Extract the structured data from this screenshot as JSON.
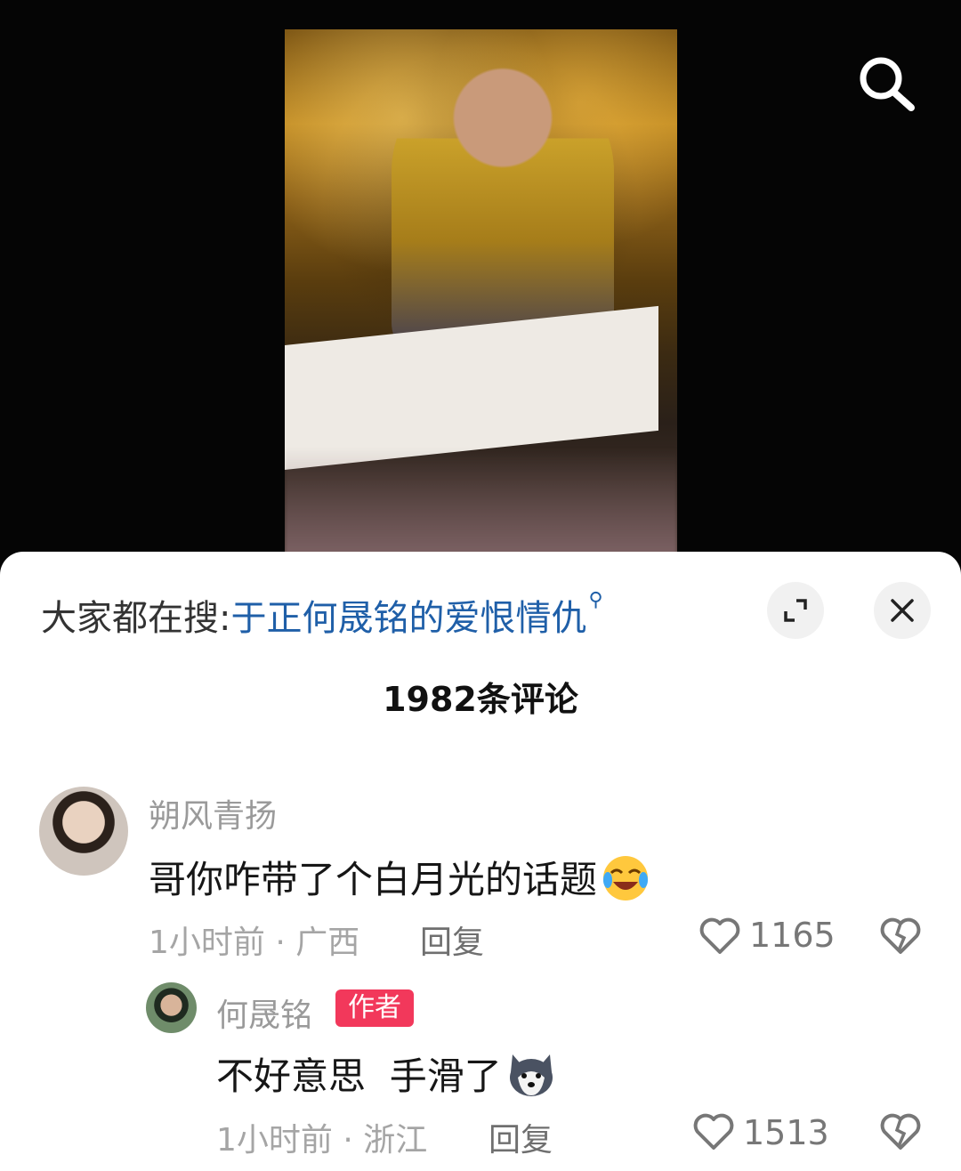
{
  "trending": {
    "prefix": "大家都在搜:",
    "topic": "于正何晟铭的爱恨情仇"
  },
  "comments_count": "1982条评论",
  "comments": [
    {
      "username": "朔风青扬",
      "text": "哥你咋带了个白月光的话题",
      "emoji": "laughing-crying-emoji",
      "time": "1小时前",
      "location": "广西",
      "reply_label": "回复",
      "likes": "1165"
    },
    {
      "username": "何晟铭",
      "badge": "作者",
      "text": "不好意思  手滑了",
      "emoji": "husky-dog-emoji",
      "time": "1小时前",
      "location": "浙江",
      "reply_label": "回复",
      "likes": "1513"
    }
  ],
  "colors": {
    "link": "#1f5fa8",
    "badge": "#f2385b",
    "muted": "#a5a5a5"
  }
}
